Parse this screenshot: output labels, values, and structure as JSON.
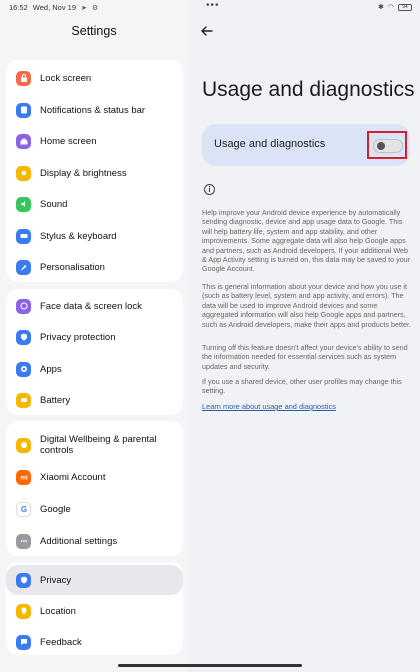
{
  "status": {
    "time": "16:52",
    "date": "Wed, Nov 19",
    "battery": "94"
  },
  "left": {
    "title": "Settings",
    "groups": [
      [
        {
          "label": "Lock screen",
          "icon": "lock-icon",
          "color": "#f26a4b"
        },
        {
          "label": "Notifications & status bar",
          "icon": "notification-icon",
          "color": "#3a7bf0"
        },
        {
          "label": "Home screen",
          "icon": "home-icon",
          "color": "#8a63e8"
        },
        {
          "label": "Display & brightness",
          "icon": "sun-icon",
          "color": "#f5b800"
        },
        {
          "label": "Sound",
          "icon": "sound-icon",
          "color": "#34c759"
        },
        {
          "label": "Stylus & keyboard",
          "icon": "keyboard-icon",
          "color": "#3a7bf0"
        },
        {
          "label": "Personalisation",
          "icon": "brush-icon",
          "color": "#3a7bf0"
        }
      ],
      [
        {
          "label": "Face data & screen lock",
          "icon": "face-icon",
          "color": "#8a63e8"
        },
        {
          "label": "Privacy protection",
          "icon": "shield-icon",
          "color": "#3a7bf0"
        },
        {
          "label": "Apps",
          "icon": "apps-icon",
          "color": "#3a7bf0"
        },
        {
          "label": "Battery",
          "icon": "battery-icon",
          "color": "#f5b800"
        }
      ],
      [
        {
          "label": "Digital Wellbeing & parental controls",
          "icon": "wellbeing-icon",
          "color": "#f5b800"
        },
        {
          "label": "Xiaomi Account",
          "icon": "mi-icon",
          "color": "#ff6900"
        },
        {
          "label": "Google",
          "icon": "google-icon",
          "color": "#ffffff"
        },
        {
          "label": "Additional settings",
          "icon": "more-icon",
          "color": "#9a9aa0"
        }
      ],
      [
        {
          "label": "Privacy",
          "icon": "privacy-icon",
          "color": "#3a7bf0"
        },
        {
          "label": "Location",
          "icon": "location-icon",
          "color": "#f5b800"
        },
        {
          "label": "Feedback",
          "icon": "feedback-icon",
          "color": "#3a7bf0"
        }
      ]
    ]
  },
  "right": {
    "title": "Usage and diagnostics",
    "toggle_label": "Usage and diagnostics",
    "toggle_on": false,
    "paragraphs": [
      "Help improve your Android device experience by automatically sending diagnostic, device and app usage data to Google. This will help battery life, system and app stability, and other improvements. Some aggregate data will also help Google apps and partners, such as Android developers. If your additional Web & App Activity setting is turned on, this data may be saved to your Google Account.",
      "This is general information about your device and how you use it (such as battery level, system and app activity, and errors). The data will be used to improve Android devices and some aggregated information will also help Google apps and partners, such as Android developers, make their apps and products better.",
      "Turning off this feature doesn't affect your device's ability to send the information needed for essential services such as system updates and security.",
      "If you use a shared device, other user profiles may change this setting."
    ],
    "link": "Learn more about usage and diagnostics"
  }
}
